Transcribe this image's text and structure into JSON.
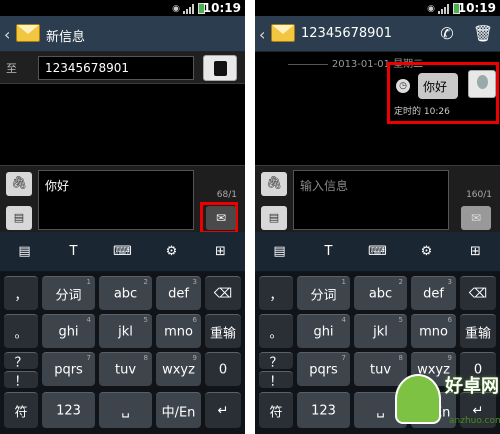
{
  "status_bar": {
    "time": "10:19"
  },
  "left": {
    "title": "新信息",
    "to_label": "至",
    "to_value": "12345678901",
    "message_text": "你好",
    "char_counter": "68/1"
  },
  "right": {
    "title": "12345678901",
    "date_label": "2013-01-01 星期二",
    "bubble_text": "你好",
    "schedule_label": "定时的 10:26",
    "input_placeholder": "输入信息",
    "char_counter": "160/1"
  },
  "keyboard": {
    "row1": [
      {
        "label": "，",
        "num": ""
      },
      {
        "label": "分词",
        "num": "1"
      },
      {
        "label": "abc",
        "num": "2"
      },
      {
        "label": "def",
        "num": "3"
      },
      {
        "label": "⌫",
        "num": ""
      }
    ],
    "row2": [
      {
        "label": "。",
        "num": ""
      },
      {
        "label": "ghi",
        "num": "4"
      },
      {
        "label": "jkl",
        "num": "5"
      },
      {
        "label": "mno",
        "num": "6"
      },
      {
        "label": "重输",
        "num": ""
      }
    ],
    "row3": [
      {
        "label": "？",
        "num": ""
      },
      {
        "label": "pqrs",
        "num": "7"
      },
      {
        "label": "tuv",
        "num": "8"
      },
      {
        "label": "wxyz",
        "num": "9"
      },
      {
        "label": "0",
        "num": ""
      }
    ],
    "row3_extra": "！",
    "row4": [
      {
        "label": "符",
        "num": ""
      },
      {
        "label": "123",
        "num": ""
      },
      {
        "label": "␣",
        "num": ""
      },
      {
        "label": "中/En",
        "num": ""
      },
      {
        "label": "↵",
        "num": ""
      }
    ]
  },
  "watermark": {
    "name": "好卓网",
    "url": "anzhuo.com"
  },
  "colors": {
    "highlight": "#e00000",
    "titlebar": "#2b3d4f",
    "key": "#3d444c"
  }
}
